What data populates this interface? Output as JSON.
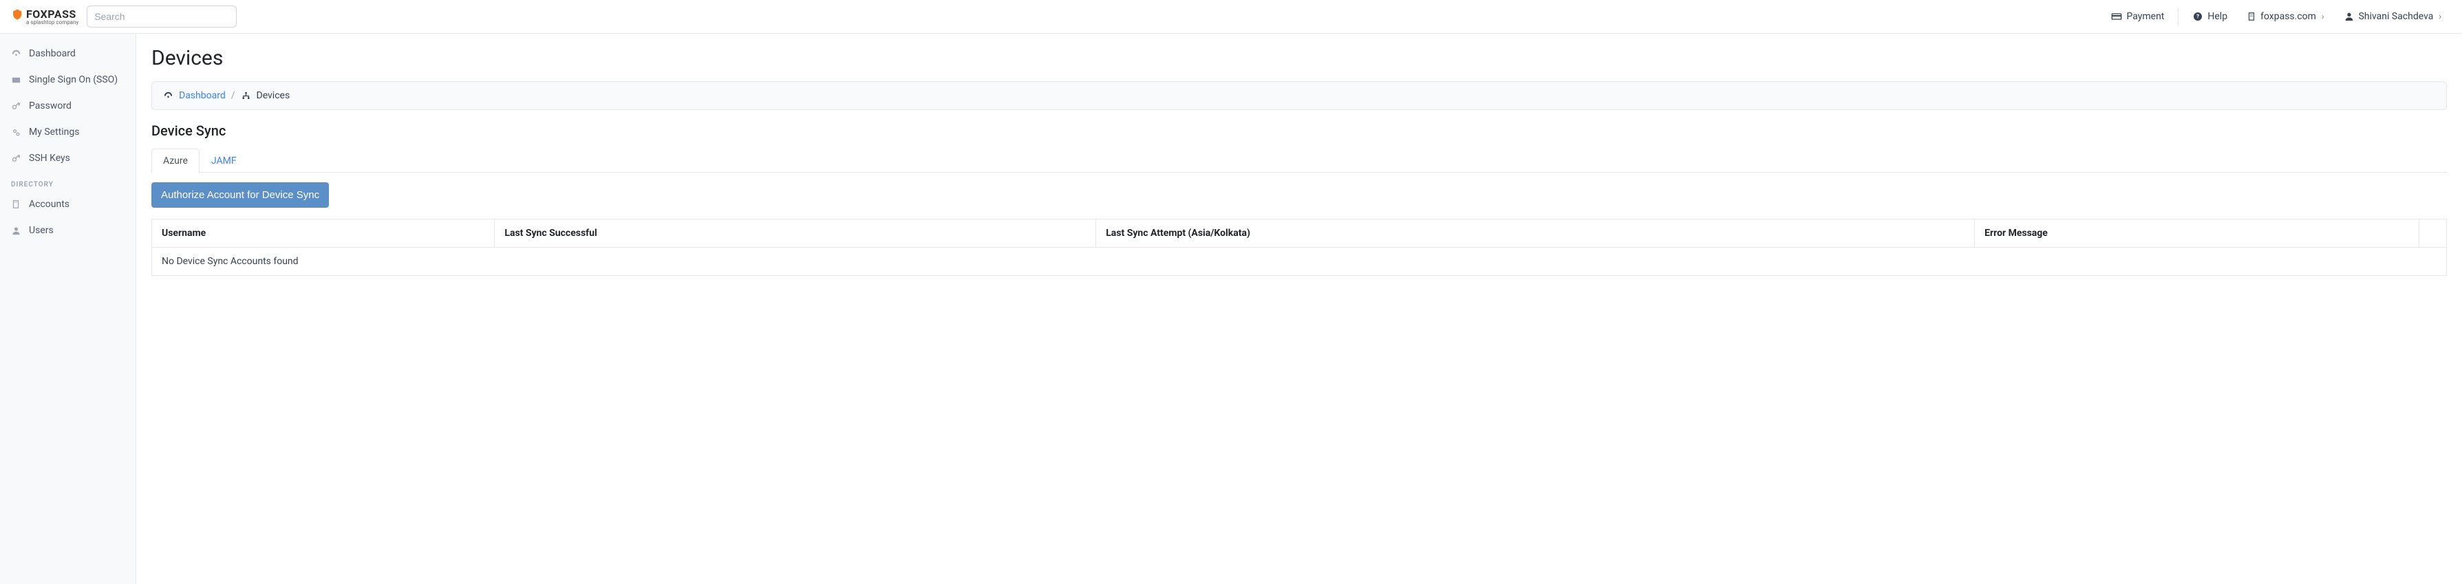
{
  "brand": {
    "name": "FOXPASS",
    "sub": "a splashtop company"
  },
  "search": {
    "placeholder": "Search"
  },
  "topnav": {
    "payment": "Payment",
    "help": "Help",
    "site": "foxpass.com",
    "user": "Shivani Sachdeva"
  },
  "sidebar": {
    "items": [
      {
        "label": "Dashboard"
      },
      {
        "label": "Single Sign On (SSO)"
      },
      {
        "label": "Password"
      },
      {
        "label": "My Settings"
      },
      {
        "label": "SSH Keys"
      }
    ],
    "section_directory": "DIRECTORY",
    "directory_items": [
      {
        "label": "Accounts"
      },
      {
        "label": "Users"
      }
    ]
  },
  "page": {
    "title": "Devices",
    "breadcrumb": {
      "root": "Dashboard",
      "current": "Devices"
    },
    "section_title": "Device Sync",
    "tabs": [
      {
        "label": "Azure",
        "active": true
      },
      {
        "label": "JAMF",
        "active": false
      }
    ],
    "authorize_button": "Authorize Account for Device Sync",
    "table": {
      "headers": [
        "Username",
        "Last Sync Successful",
        "Last Sync Attempt (Asia/Kolkata)",
        "Error Message",
        ""
      ],
      "empty": "No Device Sync Accounts found"
    }
  }
}
